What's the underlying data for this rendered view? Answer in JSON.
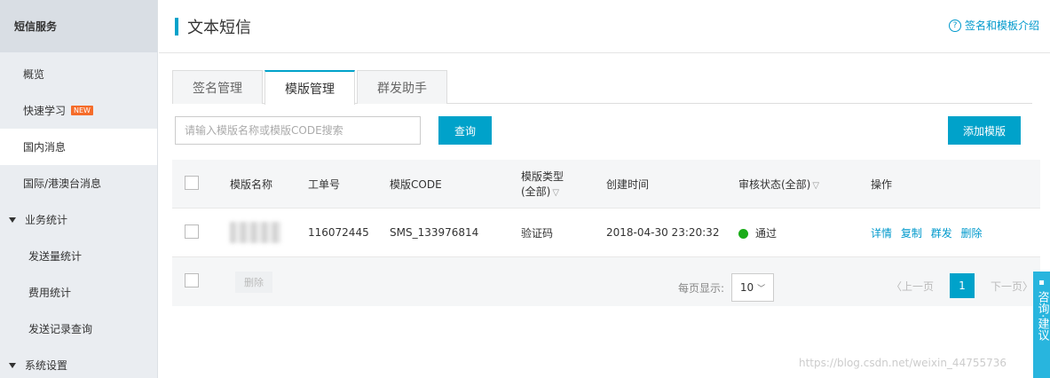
{
  "sidebar": {
    "title": "短信服务",
    "items": [
      {
        "label": "概览"
      },
      {
        "label": "快速学习",
        "badge": "NEW"
      },
      {
        "label": "国内消息"
      },
      {
        "label": "国际/港澳台消息"
      },
      {
        "label": "业务统计"
      },
      {
        "label": "发送量统计"
      },
      {
        "label": "费用统计"
      },
      {
        "label": "发送记录查询"
      },
      {
        "label": "系统设置"
      }
    ]
  },
  "header": {
    "title": "文本短信",
    "help_icon": "?",
    "help_label": "签名和模板介绍"
  },
  "tabs": [
    {
      "label": "签名管理"
    },
    {
      "label": "模版管理"
    },
    {
      "label": "群发助手"
    }
  ],
  "search": {
    "placeholder": "请输入模版名称或模版CODE搜索",
    "query_label": "查询",
    "add_label": "添加模版"
  },
  "table": {
    "columns": {
      "name": "模版名称",
      "order": "工单号",
      "code": "模版CODE",
      "type_line1": "模版类型",
      "type_line2": "(全部)",
      "time": "创建时间",
      "status": "审核状态(全部)",
      "ops": "操作"
    },
    "rows": [
      {
        "order": "116072445",
        "code": "SMS_133976814",
        "type": "验证码",
        "time": "2018-04-30 23:20:32",
        "status": "通过",
        "status_color": "#1aac19",
        "ops": [
          "详情",
          "复制",
          "群发",
          "删除"
        ]
      }
    ],
    "footer": {
      "delete_label": "删除",
      "per_page_label": "每页显示:",
      "per_page_value": "10",
      "prev_label": "上一页",
      "current_page": "1",
      "next_label": "下一页"
    }
  },
  "consult": {
    "label": "咨询·建议"
  },
  "watermark": "https://blog.csdn.net/weixin_44755736",
  "colors": {
    "accent": "#00a2ca",
    "success": "#1aac19",
    "link": "#0099cc"
  }
}
